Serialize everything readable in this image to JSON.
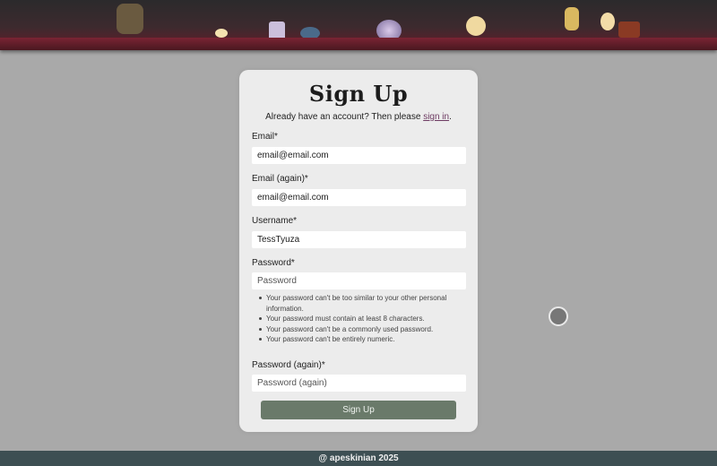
{
  "banner": {
    "image": "crystals-candles-banner"
  },
  "form": {
    "title": "Sign Up",
    "signin_prompt": "Already have an account? Then please",
    "signin_link": "sign in",
    "signin_period": ".",
    "email": {
      "label": "Email*",
      "value": "email@email.com"
    },
    "email_again": {
      "label": "Email (again)*",
      "value": "email@email.com"
    },
    "username": {
      "label": "Username*",
      "value": "TessTyuza"
    },
    "password": {
      "label": "Password*",
      "placeholder": "Password",
      "value": ""
    },
    "password_hints": [
      "Your password can't be too similar to your other personal information.",
      "Your password must contain at least 8 characters.",
      "Your password can't be a commonly used password.",
      "Your password can't be entirely numeric."
    ],
    "password_again": {
      "label": "Password (again)*",
      "placeholder": "Password (again)",
      "value": ""
    },
    "submit_label": "Sign Up"
  },
  "footer": {
    "text": "@ apeskinian 2025"
  },
  "colors": {
    "page_bg": "#a9a9a9",
    "card_bg": "#ececec",
    "button_bg": "#6a7a6a",
    "link": "#6d3a62",
    "footer_bg": "#3d4f53"
  }
}
